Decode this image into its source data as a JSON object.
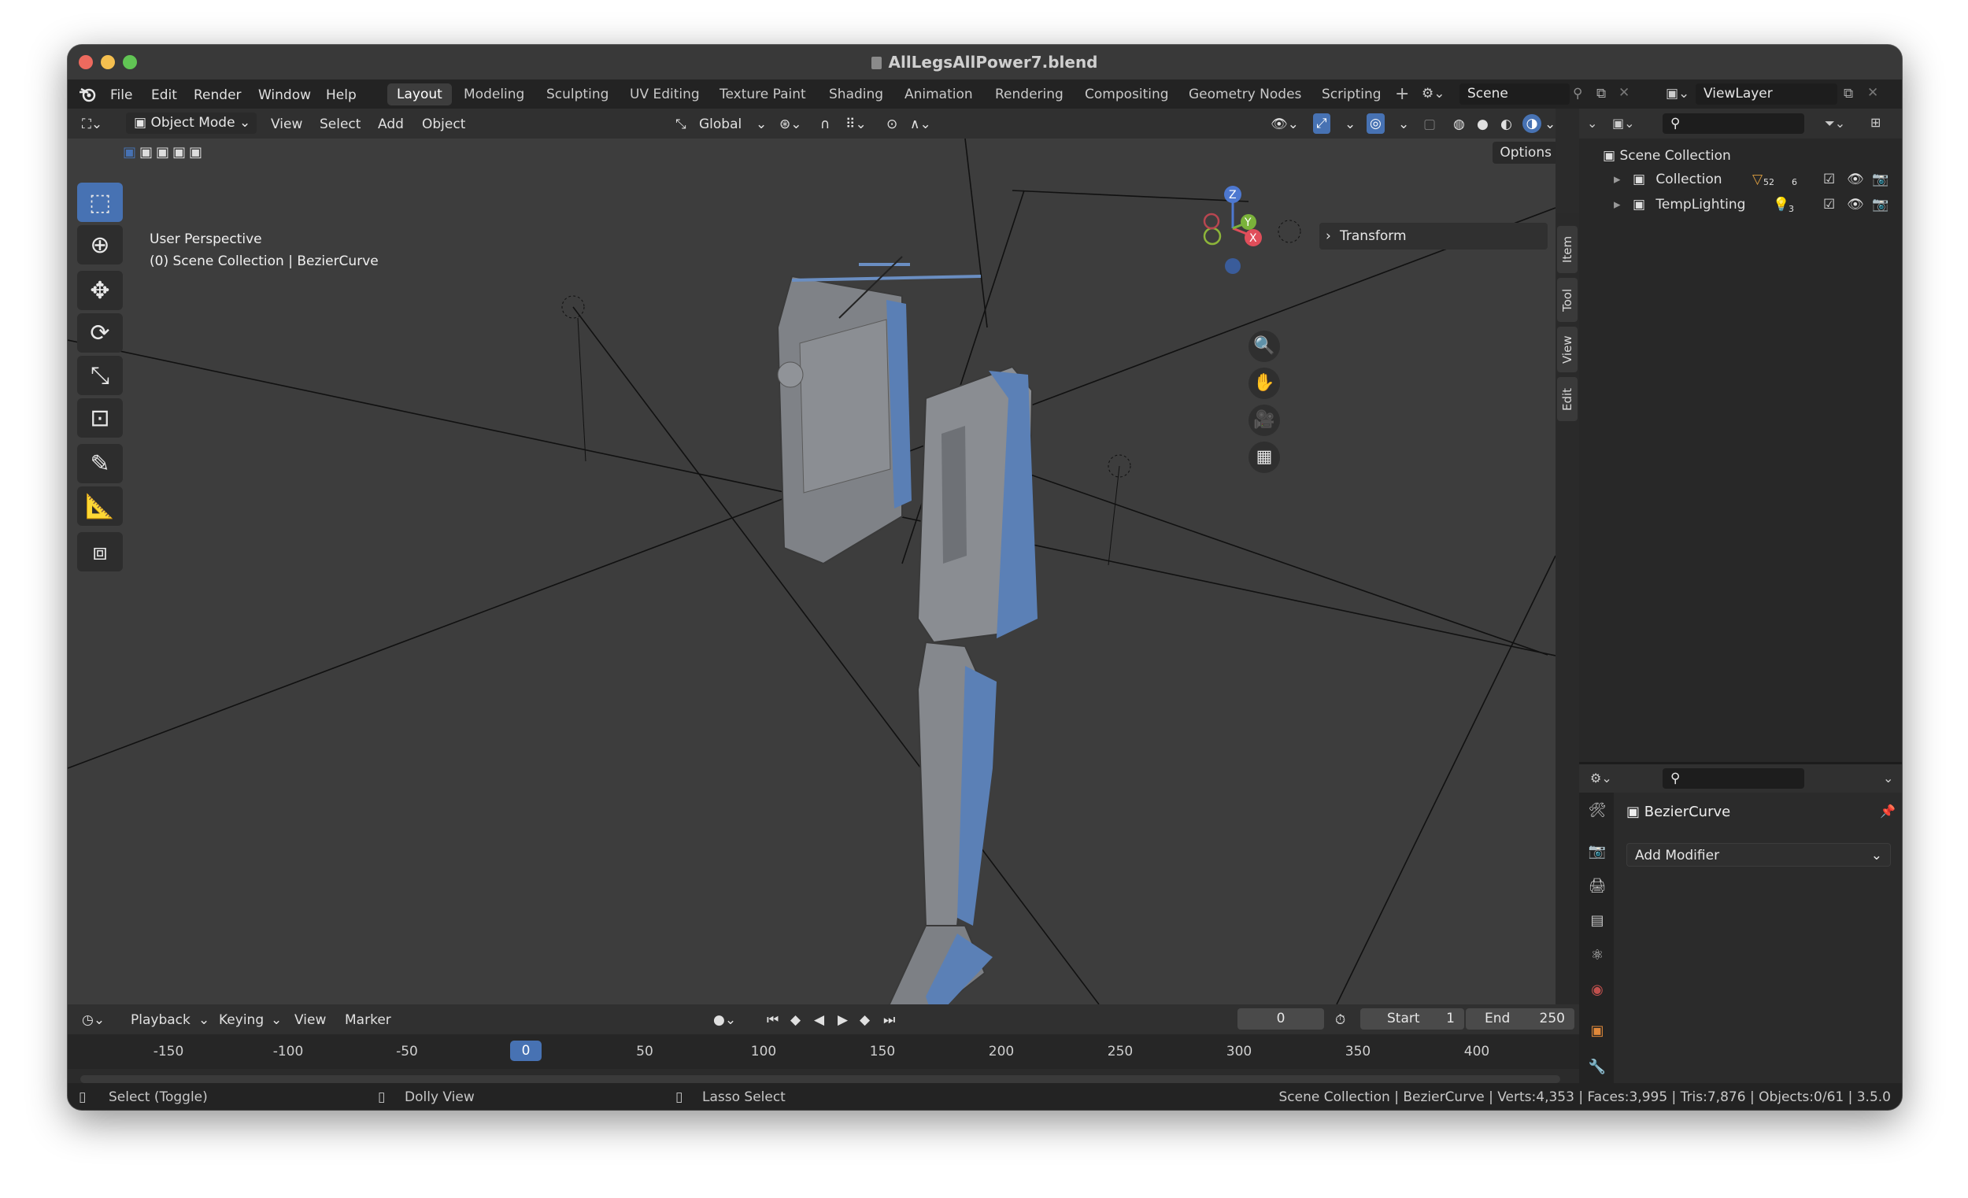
{
  "window": {
    "title": "AllLegsAllPower7.blend"
  },
  "menu": [
    "File",
    "Edit",
    "Render",
    "Window",
    "Help"
  ],
  "workspaces": [
    "Layout",
    "Modeling",
    "Sculpting",
    "UV Editing",
    "Texture Paint",
    "Shading",
    "Animation",
    "Rendering",
    "Compositing",
    "Geometry Nodes",
    "Scripting"
  ],
  "scene_field": "Scene",
  "viewlayer_field": "ViewLayer",
  "viewport_header": {
    "mode": "Object Mode",
    "menus": [
      "View",
      "Select",
      "Add",
      "Object"
    ],
    "transform_orientation": "Global"
  },
  "viewport": {
    "options_label": "Options",
    "overlay_line1": "User Perspective",
    "overlay_line2": "(0) Scene Collection | BezierCurve",
    "npanel_title": "Transform",
    "side_tabs": [
      "Item",
      "Tool",
      "View",
      "Edit"
    ]
  },
  "outliner": {
    "root": "Scene Collection",
    "items": [
      {
        "label": "Collection",
        "badge1": "52",
        "badge2": "6"
      },
      {
        "label": "TempLighting",
        "badge1": "3"
      }
    ]
  },
  "properties": {
    "object_name": "BezierCurve",
    "add_modifier_label": "Add Modifier"
  },
  "timeline": {
    "menus": [
      "Playback",
      "Keying",
      "View",
      "Marker"
    ],
    "current_frame": "0",
    "start_label": "Start",
    "start_value": "1",
    "end_label": "End",
    "end_value": "250",
    "ruler_ticks": [
      "-150",
      "-100",
      "-50",
      "0",
      "50",
      "100",
      "150",
      "200",
      "250",
      "300",
      "350",
      "400"
    ]
  },
  "statusbar": {
    "hint1": "Select (Toggle)",
    "hint2": "Dolly View",
    "hint3": "Lasso Select",
    "stats": "Scene Collection | BezierCurve | Verts:4,353 | Faces:3,995 | Tris:7,876 | Objects:0/61 | 3.5.0"
  },
  "colors": {
    "accent": "#4772b3",
    "viewport_bg": "#3d3d3d",
    "panel_bg": "#2b2b2b"
  }
}
